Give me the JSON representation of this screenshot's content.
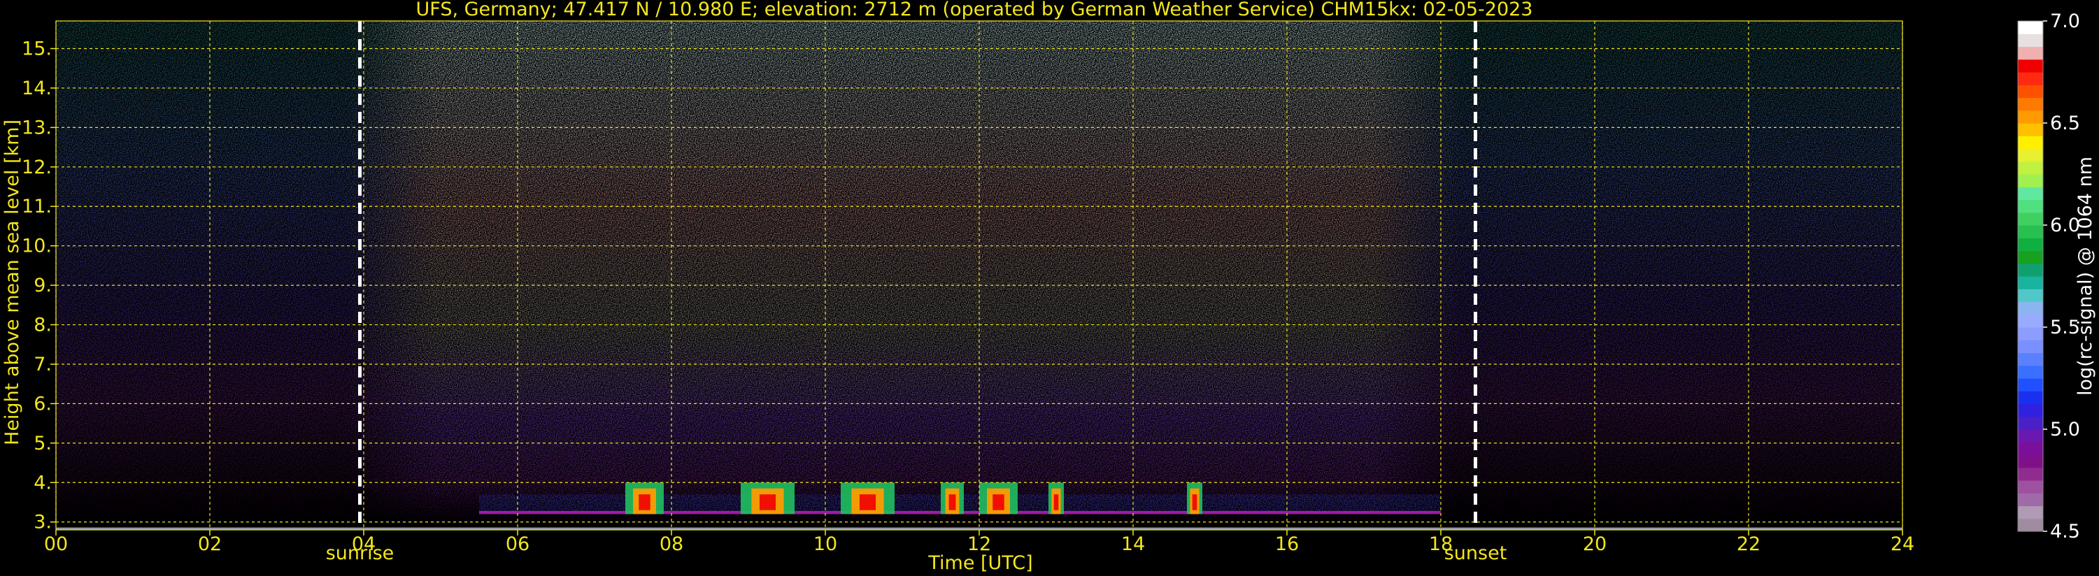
{
  "chart_data": {
    "type": "heatmap",
    "title": "UFS, Germany; 47.417 N / 10.980 E; elevation: 2712 m  (operated by German Weather Service)    CHM15kx: 02-05-2023",
    "xlabel": "Time [UTC]",
    "ylabel": "Height above mean sea level [km]",
    "xlim": [
      0,
      24
    ],
    "ylim": [
      2.8,
      15.7
    ],
    "x_ticks": [
      0,
      2,
      4,
      6,
      8,
      10,
      12,
      14,
      16,
      18,
      20,
      22,
      24
    ],
    "x_tick_labels": [
      "00",
      "02",
      "04",
      "06",
      "08",
      "10",
      "12",
      "14",
      "16",
      "18",
      "20",
      "22",
      "24"
    ],
    "y_ticks": [
      3,
      4,
      5,
      6,
      7,
      8,
      9,
      10,
      11,
      12,
      13,
      14,
      15
    ],
    "y_tick_labels": [
      "3.",
      "4.",
      "5.",
      "6.",
      "7.",
      "8.",
      "9.",
      "10.",
      "11.",
      "12.",
      "13.",
      "14.",
      "15."
    ],
    "grid": true,
    "markers": [
      {
        "label": "sunrise",
        "x": 3.95
      },
      {
        "label": "sunset",
        "x": 18.45
      }
    ],
    "colorbar": {
      "label": "log(rc-signal) @ 1064 nm",
      "range": [
        4.5,
        7.0
      ],
      "tick_values": [
        4.5,
        5.0,
        5.5,
        6.0,
        6.5,
        7.0
      ],
      "tick_labels": [
        "4.5",
        "5.0",
        "5.5",
        "6.0",
        "6.5",
        "7.0"
      ],
      "colors": [
        "#a08ca0",
        "#b09ab4",
        "#a06aa8",
        "#a050a0",
        "#902c90",
        "#80108a",
        "#7a109a",
        "#6a18b0",
        "#4a20c8",
        "#3020e0",
        "#1a30f0",
        "#2050ff",
        "#3a70ff",
        "#5a80ff",
        "#7a90ff",
        "#8c9cff",
        "#9aaaff",
        "#8cb4f0",
        "#50c8c8",
        "#18b4a0",
        "#10a070",
        "#18a020",
        "#10b040",
        "#28c050",
        "#40d060",
        "#50e080",
        "#60e8a0",
        "#a0f050",
        "#c0f040",
        "#e8f030",
        "#fff000",
        "#ffc000",
        "#ff9a00",
        "#ff7a00",
        "#ff5000",
        "#ff2a10",
        "#f00000",
        "#f0b0b0",
        "#e8e0e0",
        "#ffffff"
      ]
    },
    "features": {
      "cloud_band": {
        "height_km": [
          3.2,
          4.0
        ],
        "time_range": [
          5.5,
          18
        ]
      },
      "strong_returns": [
        {
          "start": 7.4,
          "end": 7.9
        },
        {
          "start": 8.9,
          "end": 9.6
        },
        {
          "start": 10.2,
          "end": 10.9
        },
        {
          "start": 11.5,
          "end": 11.8
        },
        {
          "start": 12.0,
          "end": 12.5
        },
        {
          "start": 12.9,
          "end": 13.1
        },
        {
          "start": 14.7,
          "end": 14.9
        }
      ]
    }
  }
}
